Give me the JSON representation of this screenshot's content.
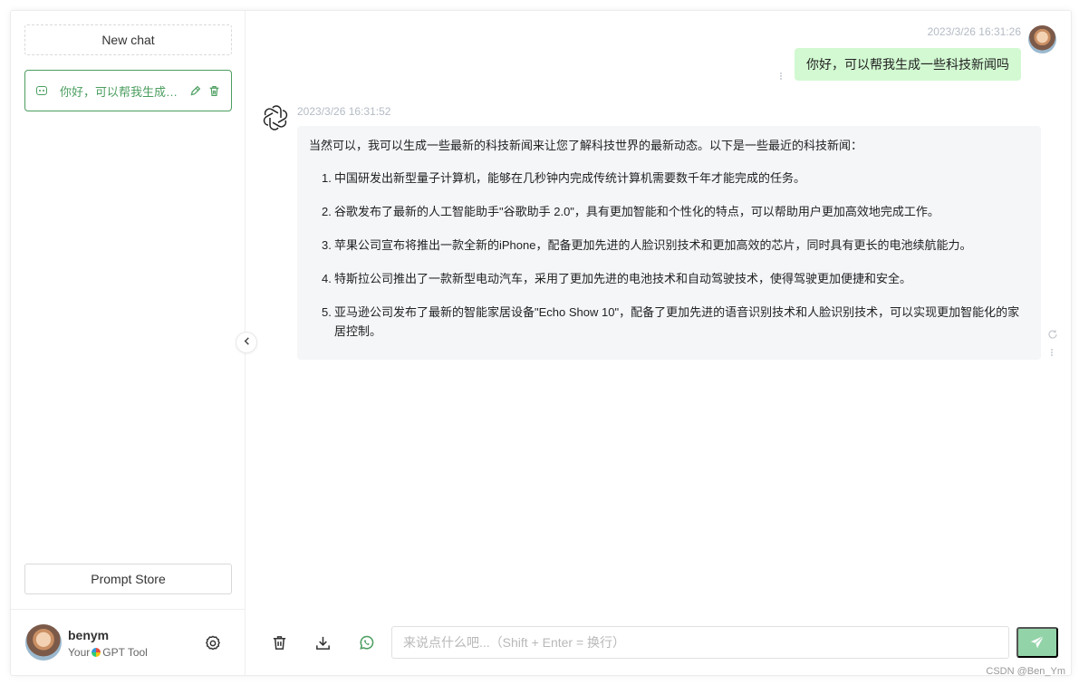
{
  "sidebar": {
    "new_chat_label": "New chat",
    "conversations": [
      {
        "title": "你好，可以帮我生成一些科技新闻吗",
        "active": true
      }
    ],
    "prompt_store_label": "Prompt Store",
    "user": {
      "name": "benym",
      "desc_prefix": "Your",
      "desc_suffix": "GPT Tool"
    }
  },
  "chat": {
    "messages": [
      {
        "role": "user",
        "time": "2023/3/26 16:31:26",
        "text": "你好，可以帮我生成一些科技新闻吗"
      },
      {
        "role": "assistant",
        "time": "2023/3/26 16:31:52",
        "intro": "当然可以，我可以生成一些最新的科技新闻来让您了解科技世界的最新动态。以下是一些最近的科技新闻：",
        "items": [
          {
            "num": "1.",
            "text": "中国研发出新型量子计算机，能够在几秒钟内完成传统计算机需要数千年才能完成的任务。"
          },
          {
            "num": "2.",
            "text": "谷歌发布了最新的人工智能助手\"谷歌助手 2.0\"，具有更加智能和个性化的特点，可以帮助用户更加高效地完成工作。"
          },
          {
            "num": "3.",
            "text": "苹果公司宣布将推出一款全新的iPhone，配备更加先进的人脸识别技术和更加高效的芯片，同时具有更长的电池续航能力。"
          },
          {
            "num": "4.",
            "text": "特斯拉公司推出了一款新型电动汽车，采用了更加先进的电池技术和自动驾驶技术，使得驾驶更加便捷和安全。"
          },
          {
            "num": "5.",
            "text": "亚马逊公司发布了最新的智能家居设备\"Echo Show 10\"，配备了更加先进的语音识别技术和人脸识别技术，可以实现更加智能化的家居控制。"
          }
        ]
      }
    ],
    "input": {
      "value": "",
      "placeholder": "来说点什么吧...（Shift + Enter = 换行）"
    }
  },
  "watermark": "CSDN @Ben_Ym",
  "colors": {
    "accent": "#4b9e5f",
    "user_bubble": "#d2f9d1",
    "assistant_bubble": "#f4f6f8",
    "send_button": "#92d3a8"
  },
  "icons": [
    "message-icon",
    "edit-icon",
    "trash-icon",
    "settings-icon",
    "chevron-left-icon",
    "openai-icon",
    "refresh-icon",
    "more-dots-icon",
    "download-icon",
    "whatsapp-icon",
    "send-icon"
  ]
}
